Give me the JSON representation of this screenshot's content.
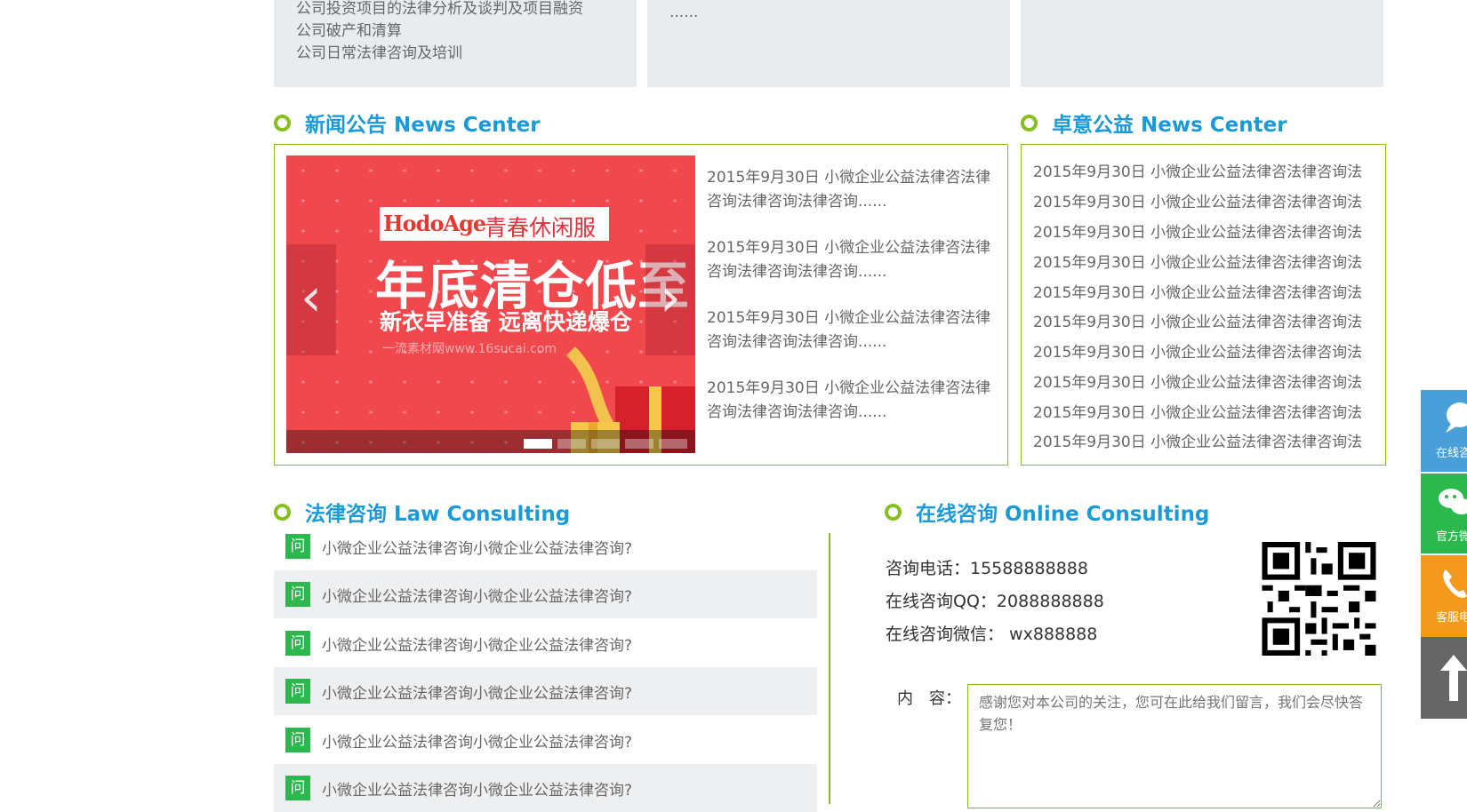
{
  "services": {
    "col1_lines": [
      "公司投资项目的法律分析及谈判及项目融资",
      "公司破产和清算",
      "公司日常法律咨询及培训"
    ],
    "col2_lines": [
      "......"
    ]
  },
  "news_section": {
    "title": "新闻公告 News Center",
    "slider": {
      "brand_logo": "HodoAge",
      "brand_text": "青春休闲服",
      "headline": "年底清仓低至",
      "subline": "新衣早准备 远离快递爆仓",
      "watermark": "一流素材网www.16sucai.com",
      "prev_icon": "chevron-left-icon",
      "next_icon": "chevron-right-icon",
      "slide_count": 5,
      "active_index": 0
    },
    "items": [
      "2015年9月30日 小微企业公益法律咨法律咨询法律咨询法律咨询......",
      "2015年9月30日 小微企业公益法律咨法律咨询法律咨询法律咨询......",
      "2015年9月30日 小微企业公益法律咨法律咨询法律咨询法律咨询......",
      "2015年9月30日 小微企业公益法律咨法律咨询法律咨询法律咨询......"
    ]
  },
  "public_section": {
    "title": "卓意公益 News Center",
    "items": [
      "2015年9月30日 小微企业公益法律咨法律咨询法",
      "2015年9月30日 小微企业公益法律咨法律咨询法",
      "2015年9月30日 小微企业公益法律咨法律咨询法",
      "2015年9月30日 小微企业公益法律咨法律咨询法",
      "2015年9月30日 小微企业公益法律咨法律咨询法",
      "2015年9月30日 小微企业公益法律咨法律咨询法",
      "2015年9月30日 小微企业公益法律咨法律咨询法",
      "2015年9月30日 小微企业公益法律咨法律咨询法",
      "2015年9月30日 小微企业公益法律咨法律咨询法",
      "2015年9月30日 小微企业公益法律咨法律咨询法"
    ]
  },
  "law_section": {
    "title": "法律咨询 Law Consulting",
    "badge": "问",
    "questions": [
      "小微企业公益法律咨询小微企业公益法律咨询?",
      "小微企业公益法律咨询小微企业公益法律咨询?",
      "小微企业公益法律咨询小微企业公益法律咨询?",
      "小微企业公益法律咨询小微企业公益法律咨询?",
      "小微企业公益法律咨询小微企业公益法律咨询?",
      "小微企业公益法律咨询小微企业公益法律咨询?"
    ]
  },
  "online_section": {
    "title": "在线咨询 Online Consulting",
    "phone": "咨询电话：15588888888",
    "qq": "在线咨询QQ：2088888888",
    "wechat": "在线咨询微信：  wx888888",
    "content_label": "内　容：",
    "content_placeholder": "感谢您对本公司的关注，您可在此给我们留言，我们会尽快答复您！",
    "qr_icon": "qr-code-icon"
  },
  "side_bar": {
    "items": [
      {
        "label": "在线咨",
        "icon": "chat-bubble-icon",
        "color": "#4a9fd8"
      },
      {
        "label": "官方微",
        "icon": "wechat-icon",
        "color": "#2db84d"
      },
      {
        "label": "客服电",
        "icon": "phone-icon",
        "color": "#f39a1e"
      },
      {
        "label": "",
        "icon": "arrow-up-icon",
        "color": "#666666"
      }
    ]
  },
  "colors": {
    "accent_green": "#86c01b",
    "title_blue": "#1a9ad6",
    "badge_green": "#2db84d"
  }
}
